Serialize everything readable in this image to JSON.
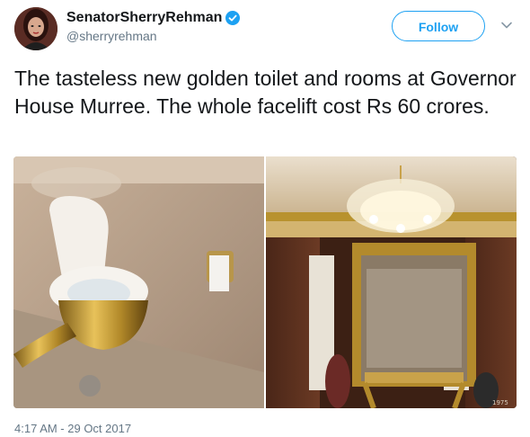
{
  "user": {
    "display_name": "SenatorSherryRehman",
    "handle": "@sherryrehman",
    "verified": true
  },
  "follow_label": "Follow",
  "tweet": {
    "text": "The tasteless new golden toilet and rooms at Governor House Murree. The whole facelift cost Rs 60 crores.",
    "timestamp": "4:17 AM - 29 Oct 2017"
  },
  "media": {
    "photo_left_corner_label": "",
    "photo_right_corner_label": "1975"
  },
  "colors": {
    "accent": "#1da1f2",
    "text_primary": "#14171a",
    "text_secondary": "#657786"
  },
  "icons": [
    "verified-badge-icon",
    "chevron-down-icon"
  ]
}
